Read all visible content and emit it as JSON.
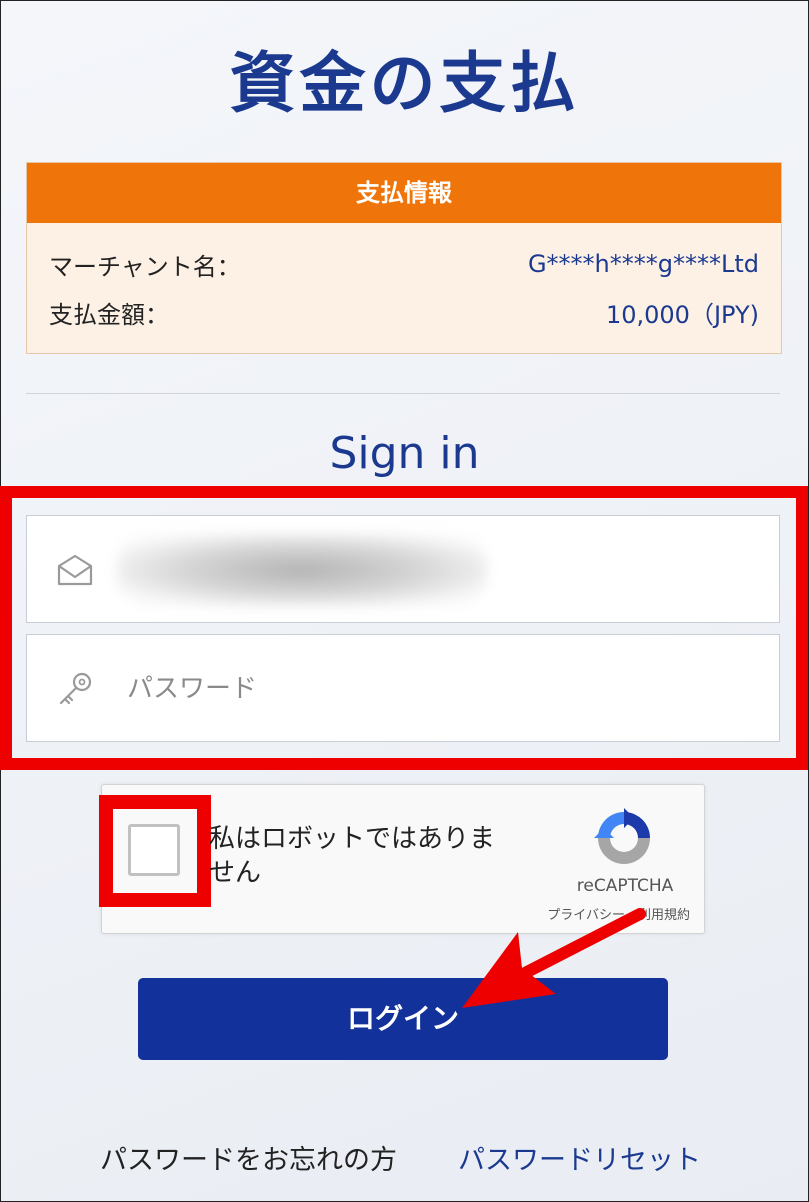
{
  "page": {
    "title": "資金の支払",
    "signin_heading": "Sign in"
  },
  "payment_info": {
    "header": "支払情報",
    "merchant_label": "マーチャント名：",
    "merchant_value": "G****h****g****Ltd",
    "amount_label": "支払金額：",
    "amount_value": "10,000（JPY)"
  },
  "form": {
    "email_icon": "envelope-icon",
    "password_icon": "key-icon",
    "password_placeholder": "パスワード"
  },
  "captcha": {
    "text": "私はロボットではありません",
    "brand": "reCAPTCHA",
    "links": "プライバシー - 利用規約"
  },
  "login_button": "ログイン",
  "footer": {
    "forgot_text": "パスワードをお忘れの方",
    "reset_link": "パスワードリセット"
  },
  "colors": {
    "accent": "#1b3a8f",
    "header_orange": "#ef7409",
    "button": "#12319a",
    "annotation_red": "#ee0000"
  }
}
